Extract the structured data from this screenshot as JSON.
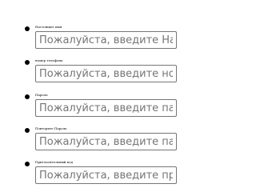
{
  "fields": [
    {
      "label": "Настоящее имя",
      "placeholder": "Пожалуйста, введите Настоящее имя"
    },
    {
      "label": "номер телефона",
      "placeholder": "Пожалуйста, введите номер телефона"
    },
    {
      "label": "Пароль",
      "placeholder": "Пожалуйста, введите пароль"
    },
    {
      "label": "Повторите Пароль",
      "placeholder": "Пожалуйста, введите пароль еще раз"
    },
    {
      "label": "Пригласительный код",
      "placeholder": "Пожалуйста, введите пригласительный код"
    }
  ]
}
